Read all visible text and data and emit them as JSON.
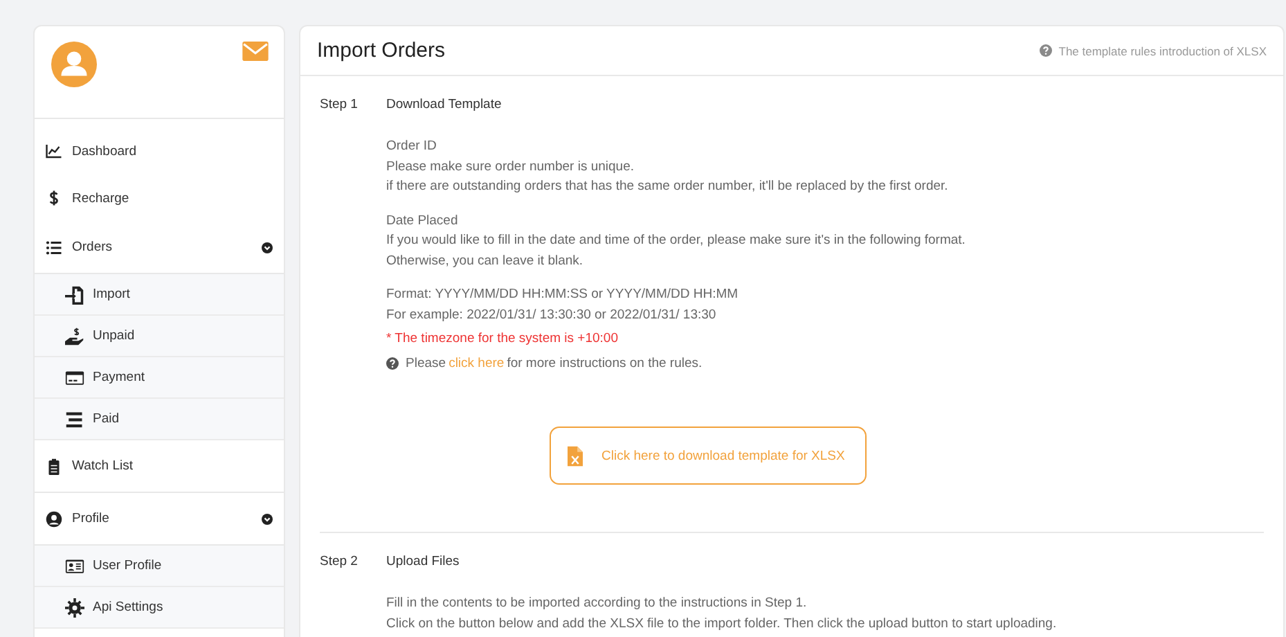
{
  "sidebar": {
    "items": [
      {
        "label": "Dashboard"
      },
      {
        "label": "Recharge"
      },
      {
        "label": "Orders",
        "expanded": true,
        "children": [
          {
            "label": "Import"
          },
          {
            "label": "Unpaid"
          },
          {
            "label": "Payment"
          },
          {
            "label": "Paid"
          }
        ]
      },
      {
        "label": "Watch List"
      },
      {
        "label": "Profile",
        "expanded": true,
        "children": [
          {
            "label": "User Profile"
          },
          {
            "label": "Api Settings"
          }
        ]
      }
    ]
  },
  "page": {
    "title": "Import Orders",
    "help_link": "The template rules introduction of XLSX",
    "steps": [
      {
        "number": "Step 1",
        "title": "Download Template",
        "blocks": [
          {
            "kind": "para",
            "lines": [
              "Order ID",
              "Please make sure order number is unique.",
              "if there are outstanding orders that has the same order number, it'll be replaced by the first order."
            ]
          },
          {
            "kind": "para",
            "lines": [
              "Date Placed",
              "If you would like to fill in the date and time of the order, please make sure it's in the following format.",
              "Otherwise, you can leave it blank."
            ]
          },
          {
            "kind": "para",
            "lines": [
              "Format: YYYY/MM/DD HH:MM:SS or YYYY/MM/DD HH:MM",
              "For example: 2022/01/31/ 13:30:30 or 2022/01/31/ 13:30"
            ]
          },
          {
            "kind": "warning",
            "text": "* The timezone for the system is +10:00"
          },
          {
            "kind": "help",
            "before": "Please",
            "link": "click here",
            "after": "for more instructions on the rules."
          },
          {
            "kind": "button",
            "label": "Click here to download template for XLSX"
          }
        ]
      },
      {
        "number": "Step 2",
        "title": "Upload Files",
        "blocks": [
          {
            "kind": "para",
            "lines": [
              "Fill in the contents to be imported according to the instructions in Step 1.",
              "Click on the button below and add the XLSX file to the import folder. Then click the upload button to start uploading."
            ]
          }
        ]
      }
    ]
  }
}
